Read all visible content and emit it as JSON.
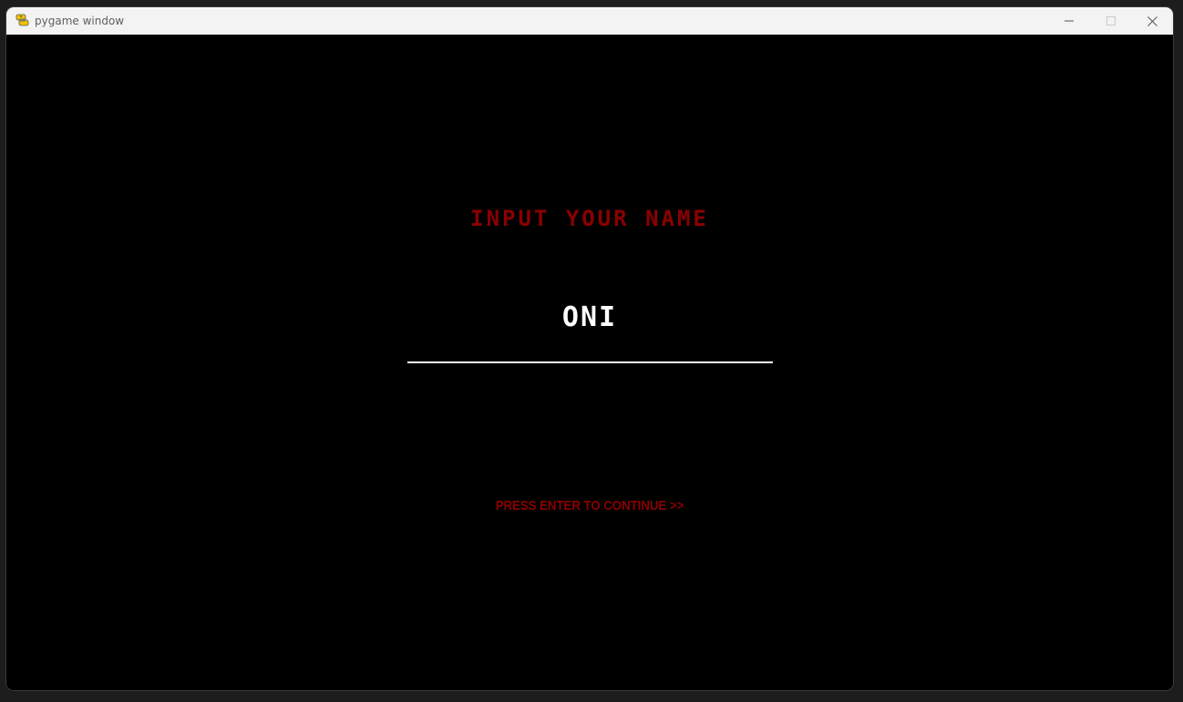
{
  "window": {
    "title": "pygame window",
    "icon": "pygame-snake-icon",
    "controls": {
      "minimize_icon": "minimize-icon",
      "maximize_icon": "maximize-icon",
      "close_icon": "close-icon"
    }
  },
  "game": {
    "prompt": "INPUT YOUR NAME",
    "name_value": "ONI",
    "continue_hint": "PRESS ENTER TO CONTINUE >>"
  },
  "colors": {
    "background": "#000000",
    "accent_red": "#8b0000",
    "input_text": "#ffffff",
    "titlebar": "#f3f3f3"
  }
}
